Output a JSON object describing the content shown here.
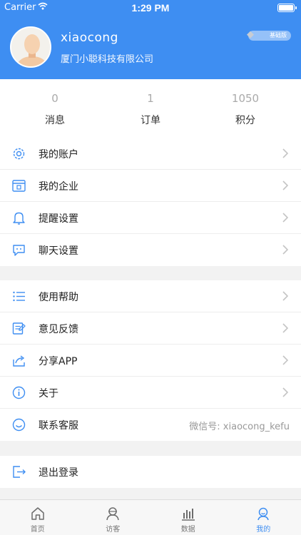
{
  "status_bar": {
    "carrier": "Carrier",
    "time": "1:29 PM"
  },
  "profile": {
    "name": "xiaocong",
    "company": "厦门小聪科技有限公司",
    "membership": "基础版"
  },
  "stats": [
    {
      "value": "0",
      "label": "消息"
    },
    {
      "value": "1",
      "label": "订单"
    },
    {
      "value": "1050",
      "label": "积分"
    }
  ],
  "menu_group1": [
    {
      "label": "我的账户",
      "icon": "gear-icon"
    },
    {
      "label": "我的企业",
      "icon": "enterprise-icon"
    },
    {
      "label": "提醒设置",
      "icon": "bell-icon"
    },
    {
      "label": "聊天设置",
      "icon": "chat-icon"
    }
  ],
  "menu_group2": [
    {
      "label": "使用帮助",
      "icon": "list-icon"
    },
    {
      "label": "意见反馈",
      "icon": "feedback-icon"
    },
    {
      "label": "分享APP",
      "icon": "share-icon"
    },
    {
      "label": "关于",
      "icon": "info-icon"
    },
    {
      "label": "联系客服",
      "icon": "service-icon",
      "extra": "微信号: xiaocong_kefu"
    }
  ],
  "logout": {
    "label": "退出登录",
    "icon": "logout-icon"
  },
  "tabs": [
    {
      "label": "首页",
      "icon": "home-icon",
      "active": false
    },
    {
      "label": "访客",
      "icon": "visitors-icon",
      "active": false
    },
    {
      "label": "数据",
      "icon": "data-icon",
      "active": false
    },
    {
      "label": "我的",
      "icon": "profile-icon",
      "active": true
    }
  ],
  "colors": {
    "brand": "#3e8ef2",
    "background": "#f2f2f2"
  }
}
